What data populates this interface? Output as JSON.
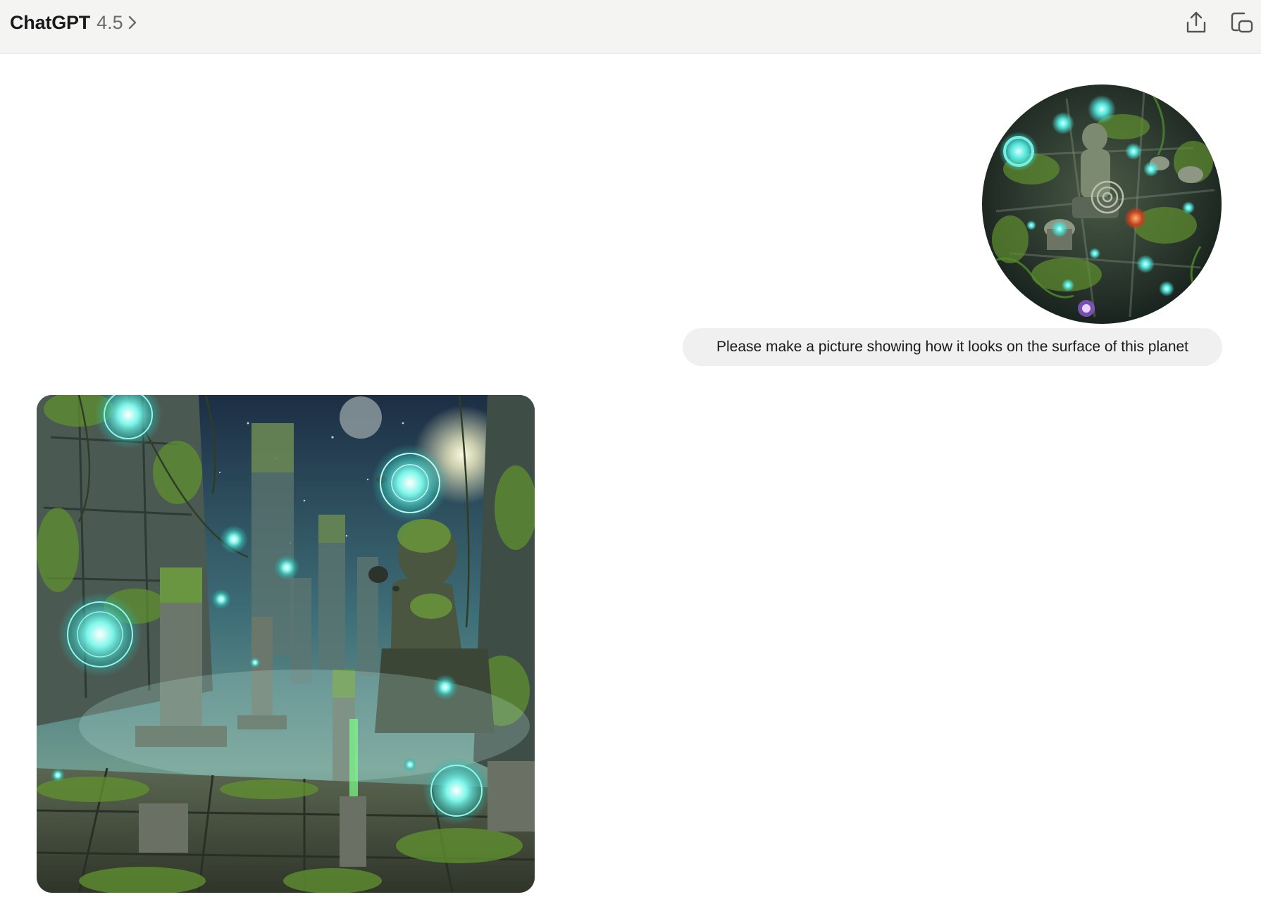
{
  "header": {
    "model_name": "ChatGPT",
    "model_version": "4.5",
    "chevron_icon": "chevron-right-icon",
    "share_icon": "share-upload-icon",
    "new_chat_icon": "new-chat-icon"
  },
  "conversation": {
    "user_message": {
      "image_kind": "circular-planet-image",
      "text": "Please make a picture showing how it looks on the surface of this planet"
    },
    "assistant_message": {
      "image_kind": "generated-image"
    }
  },
  "colors": {
    "header_bg": "#f4f4f3",
    "bubble_bg": "#f0f0f0",
    "glow": "#6ff2e6",
    "moss": "#5f8f2f"
  }
}
